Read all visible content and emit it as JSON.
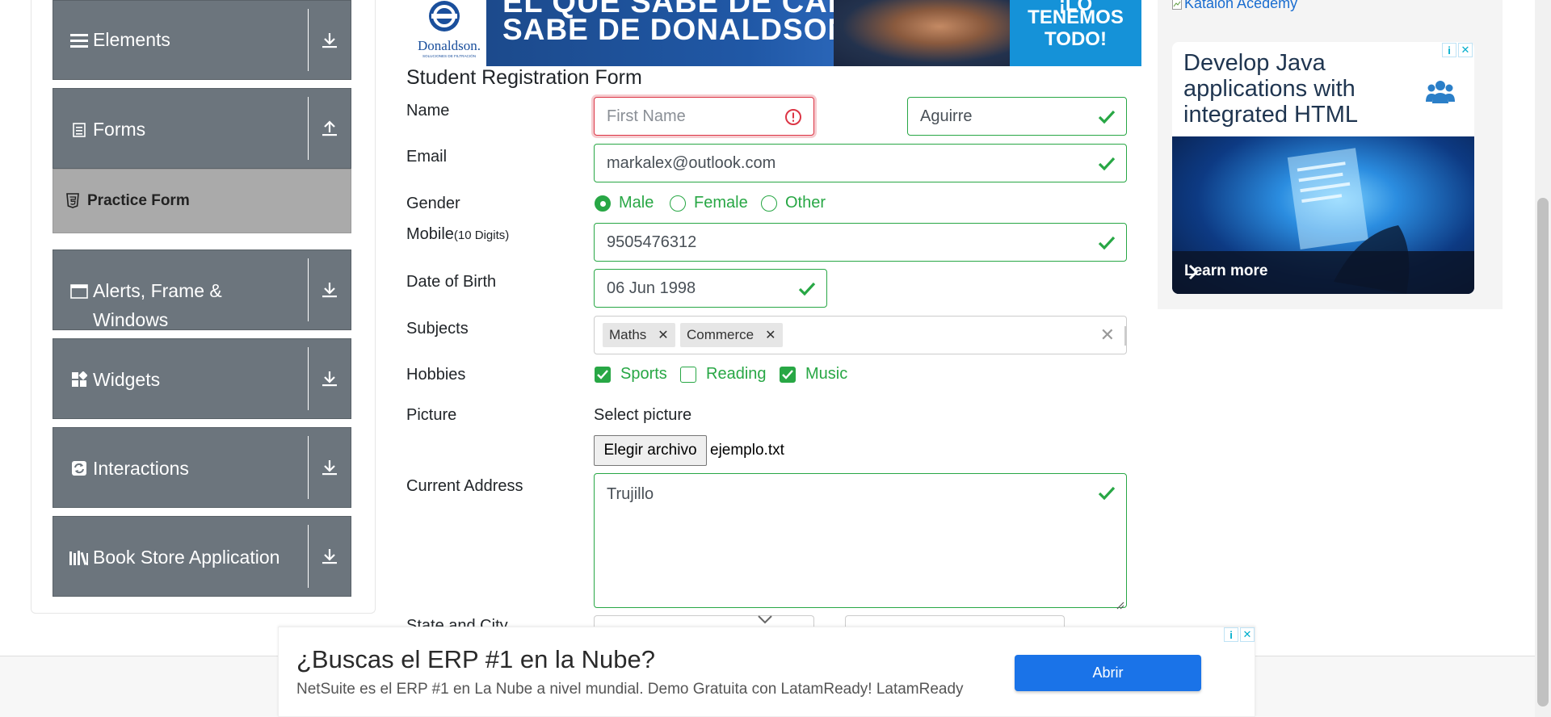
{
  "sidebar": {
    "groups": [
      {
        "label": "Elements"
      },
      {
        "label": "Forms"
      },
      {
        "label": "Alerts, Frame &",
        "label2": "Windows"
      },
      {
        "label": "Widgets"
      },
      {
        "label": "Interactions"
      },
      {
        "label": "Book Store Application"
      }
    ],
    "active_item": "Practice Form"
  },
  "banner": {
    "brand": "Donaldson.",
    "brand_sub": "SOLUCIONES DE FILTRACIÓN",
    "line1": "EL QUE SABE DE CAMIONES",
    "line2": "SABE DE DONALDSON",
    "right1": "¡LO",
    "right2": "TENEMOS",
    "right3": "TODO!"
  },
  "form": {
    "title": "Student Registration Form",
    "labels": {
      "name": "Name",
      "email": "Email",
      "gender": "Gender",
      "mobile": "Mobile",
      "mobile_hint": "(10 Digits)",
      "dob": "Date of Birth",
      "subjects": "Subjects",
      "hobbies": "Hobbies",
      "picture": "Picture",
      "address": "Current Address",
      "state_city": "State and City"
    },
    "first_name": {
      "placeholder": "First Name",
      "value": ""
    },
    "last_name": {
      "value": "Aguirre"
    },
    "email": {
      "value": "markalex@outlook.com"
    },
    "gender": {
      "options": [
        "Male",
        "Female",
        "Other"
      ],
      "selected": "Male"
    },
    "mobile": {
      "value": "9505476312"
    },
    "dob": {
      "value": "06 Jun 1998"
    },
    "subjects": [
      "Maths",
      "Commerce"
    ],
    "hobbies": [
      {
        "label": "Sports",
        "checked": true
      },
      {
        "label": "Reading",
        "checked": false
      },
      {
        "label": "Music",
        "checked": true
      }
    ],
    "picture": {
      "select_label": "Select picture",
      "button": "Elegir archivo",
      "file": "ejemplo.txt"
    },
    "address": {
      "value": "Trujillo"
    }
  },
  "right_ad": {
    "link": "Katalon Acedemy",
    "headline": "Develop Java applications with integrated HTML",
    "cta": "Learn more"
  },
  "bottom_ad": {
    "headline": "¿Buscas el ERP #1 en la Nube?",
    "description": "NetSuite es el ERP #1 en La Nube a nivel mundial. Demo Gratuita con LatamReady! LatamReady",
    "button": "Abrir"
  },
  "colors": {
    "valid": "#28a745",
    "invalid": "#dc3545",
    "sidebar_group": "#6c757d",
    "sidebar_active": "#aaaaaa",
    "ad_button": "#1a73e8"
  }
}
